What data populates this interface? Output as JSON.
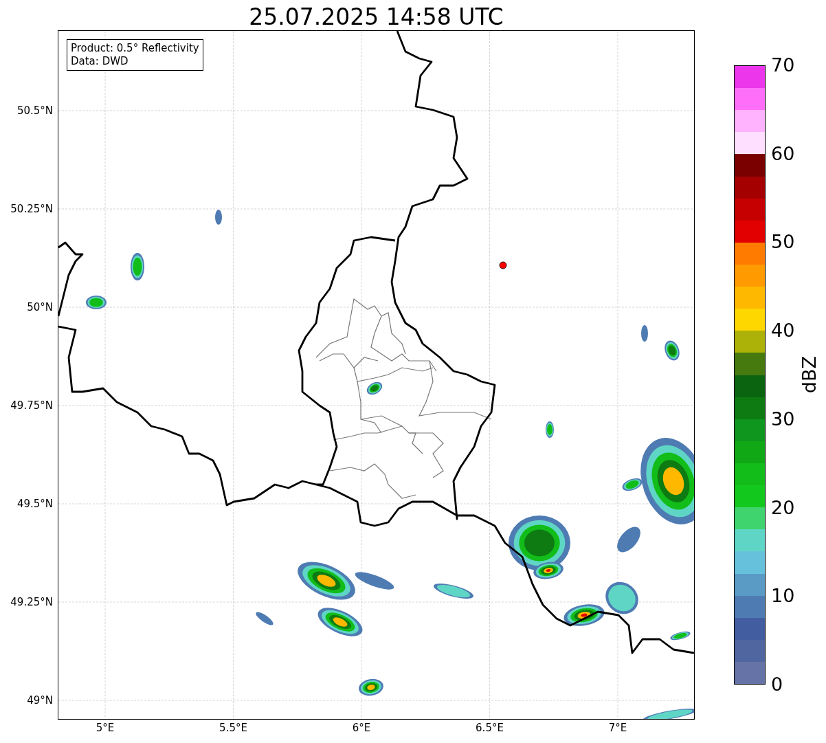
{
  "title": "25.07.2025 14:58 UTC",
  "legend": [
    "Product: 0.5° Reflectivity",
    "Data: DWD"
  ],
  "x_ticks": [
    "5°E",
    "5.5°E",
    "6°E",
    "6.5°E",
    "7°E"
  ],
  "y_ticks": [
    "50.5°N",
    "50.25°N",
    "50°N",
    "49.75°N",
    "49.5°N",
    "49.25°N",
    "49°N"
  ],
  "colorbar": {
    "label": "dBZ",
    "ticks": [
      "70",
      "60",
      "50",
      "40",
      "30",
      "20",
      "10",
      "0"
    ],
    "bins": [
      {
        "color": "#6673a6"
      },
      {
        "color": "#5066a0"
      },
      {
        "color": "#435ea0"
      },
      {
        "color": "#4f7bb3"
      },
      {
        "color": "#5a9bc6"
      },
      {
        "color": "#66c1dc"
      },
      {
        "color": "#5fd6c5"
      },
      {
        "color": "#3fd46d"
      },
      {
        "color": "#13c81c"
      },
      {
        "color": "#12bd1a"
      },
      {
        "color": "#10a815"
      },
      {
        "color": "#0e961e"
      },
      {
        "color": "#0d7b12"
      },
      {
        "color": "#0b6410"
      },
      {
        "color": "#467a0f"
      },
      {
        "color": "#adb208"
      },
      {
        "color": "#ffd700"
      },
      {
        "color": "#ffb800"
      },
      {
        "color": "#ff9a00"
      },
      {
        "color": "#ff7b00"
      },
      {
        "color": "#e30000"
      },
      {
        "color": "#c60000"
      },
      {
        "color": "#a50000"
      },
      {
        "color": "#7a0000"
      },
      {
        "color": "#ffdfff"
      },
      {
        "color": "#ffb3ff"
      },
      {
        "color": "#ff6ef9"
      },
      {
        "color": "#ec36ec"
      }
    ]
  }
}
